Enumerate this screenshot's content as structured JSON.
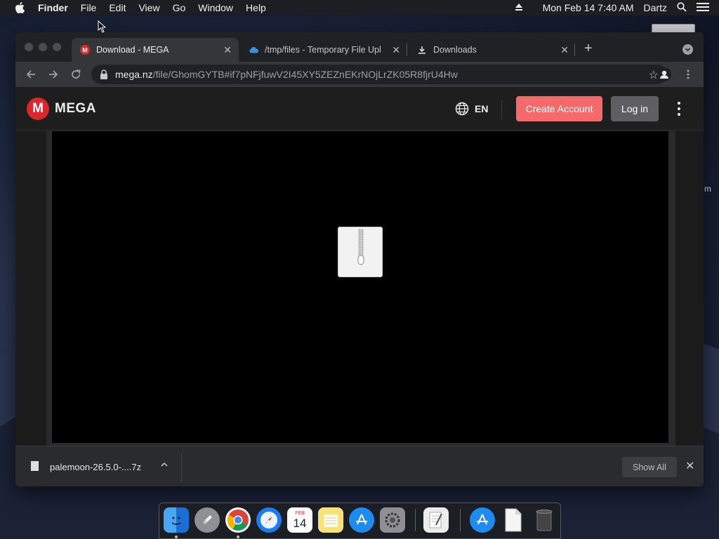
{
  "menubar": {
    "app_name": "Finder",
    "items": [
      "File",
      "Edit",
      "View",
      "Go",
      "Window",
      "Help"
    ],
    "datetime": "Mon Feb 14  7:40 AM",
    "user": "Dartz"
  },
  "desktop": {
    "partial_label": "m"
  },
  "browser": {
    "tabs": [
      {
        "title": "Download - MEGA",
        "active": true,
        "icon": "mega-icon"
      },
      {
        "title": "/tmp/files - Temporary File Upl",
        "active": false,
        "icon": "cloud-icon"
      },
      {
        "title": "Downloads",
        "active": false,
        "icon": "download-icon"
      }
    ],
    "address": {
      "host": "mega.nz",
      "path": "/file/GhomGYTB#if7pNFjfuwV2I45XY5ZEZnEKrNOjLrZK05R8fjrU4Hw"
    }
  },
  "mega": {
    "logo_letter": "M",
    "brand": "MEGA",
    "language": "EN",
    "create_account": "Create Account",
    "login": "Log in"
  },
  "download_bar": {
    "filename": "palemoon-26.5.0-....7z",
    "show_all": "Show All"
  },
  "dock": {
    "calendar_month": "FEB",
    "calendar_day": "14"
  },
  "colors": {
    "mega_red": "#d9272e",
    "create_button": "#f46a6a",
    "login_button": "#5f5f62"
  }
}
